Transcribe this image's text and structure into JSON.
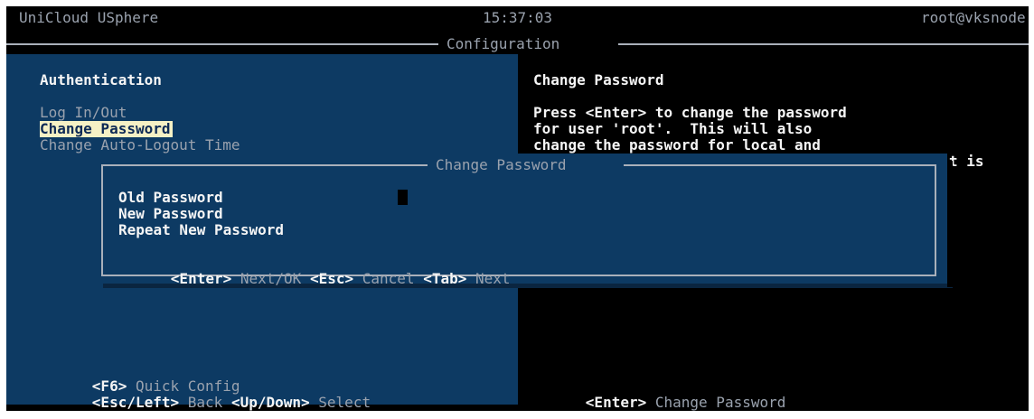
{
  "header": {
    "app_title": "UniCloud USphere",
    "time": "15:37:03",
    "user_host": "root@vksnode",
    "panel_title": "Configuration"
  },
  "menu": {
    "section_title": "Authentication",
    "items": [
      {
        "label": "Log In/Out",
        "selected": false
      },
      {
        "label": "Change Password",
        "selected": true
      },
      {
        "label": "Change Auto-Logout Time",
        "selected": false
      }
    ]
  },
  "help": {
    "title": "Change Password",
    "lines": [
      "Press <Enter> to change the password",
      "for user 'root'.  This will also",
      "change the password for local and"
    ],
    "trailing_fragment": "t is"
  },
  "dialog": {
    "title": "Change Password",
    "fields": [
      {
        "label": "Old Password",
        "value": ""
      },
      {
        "label": "New Password",
        "value": ""
      },
      {
        "label": "Repeat New Password",
        "value": ""
      }
    ],
    "hints": [
      {
        "key": "<Enter>",
        "action": "Next/OK"
      },
      {
        "key": "<Esc>",
        "action": "Cancel"
      },
      {
        "key": "<Tab>",
        "action": "Next"
      }
    ]
  },
  "footer_left": {
    "line1": [
      {
        "key": "<F6>",
        "action": "Quick Config"
      }
    ],
    "line2": [
      {
        "key": "<Esc/Left>",
        "action": "Back"
      },
      {
        "key": "<Up/Down>",
        "action": "Select"
      }
    ]
  },
  "footer_right": [
    {
      "key": "<Enter>",
      "action": "Change Password"
    }
  ],
  "colors": {
    "panel_blue": "#0d3a63",
    "background": "#000000",
    "highlight": "#f5f1c5",
    "border": "#a9b0ba",
    "dim_text": "#9aa2ae"
  }
}
